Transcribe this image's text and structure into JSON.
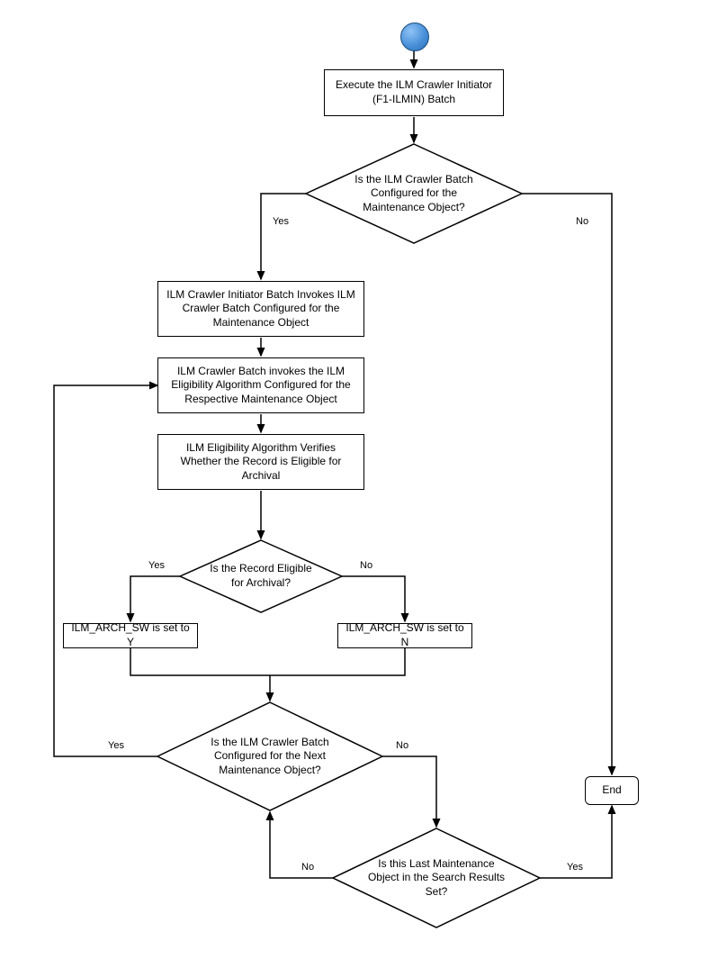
{
  "nodes": {
    "start": "",
    "box_execute": "Execute the ILM Crawler Initiator (F1-ILMIN) Batch",
    "diamond_configured": "Is the ILM Crawler Batch Configured for the Maintenance Object?",
    "box_invokes_crawler": "ILM Crawler Initiator Batch Invokes ILM Crawler Batch Configured for the Maintenance Object",
    "box_invokes_elig": "ILM Crawler Batch invokes the ILM Eligibility Algorithm Configured for the Respective Maintenance Object",
    "box_verifies": "ILM Eligibility Algorithm Verifies Whether the Record is Eligible for Archival",
    "diamond_eligible": "Is the Record Eligible for Archival?",
    "box_set_y": "ILM_ARCH_SW is set to Y",
    "box_set_n": "ILM_ARCH_SW is set to N",
    "diamond_next": "Is the ILM Crawler Batch Configured for the Next Maintenance Object?",
    "diamond_last": "Is this Last Maintenance Object in the Search Results Set?",
    "box_end": "End"
  },
  "edges": {
    "yes": "Yes",
    "no": "No"
  }
}
